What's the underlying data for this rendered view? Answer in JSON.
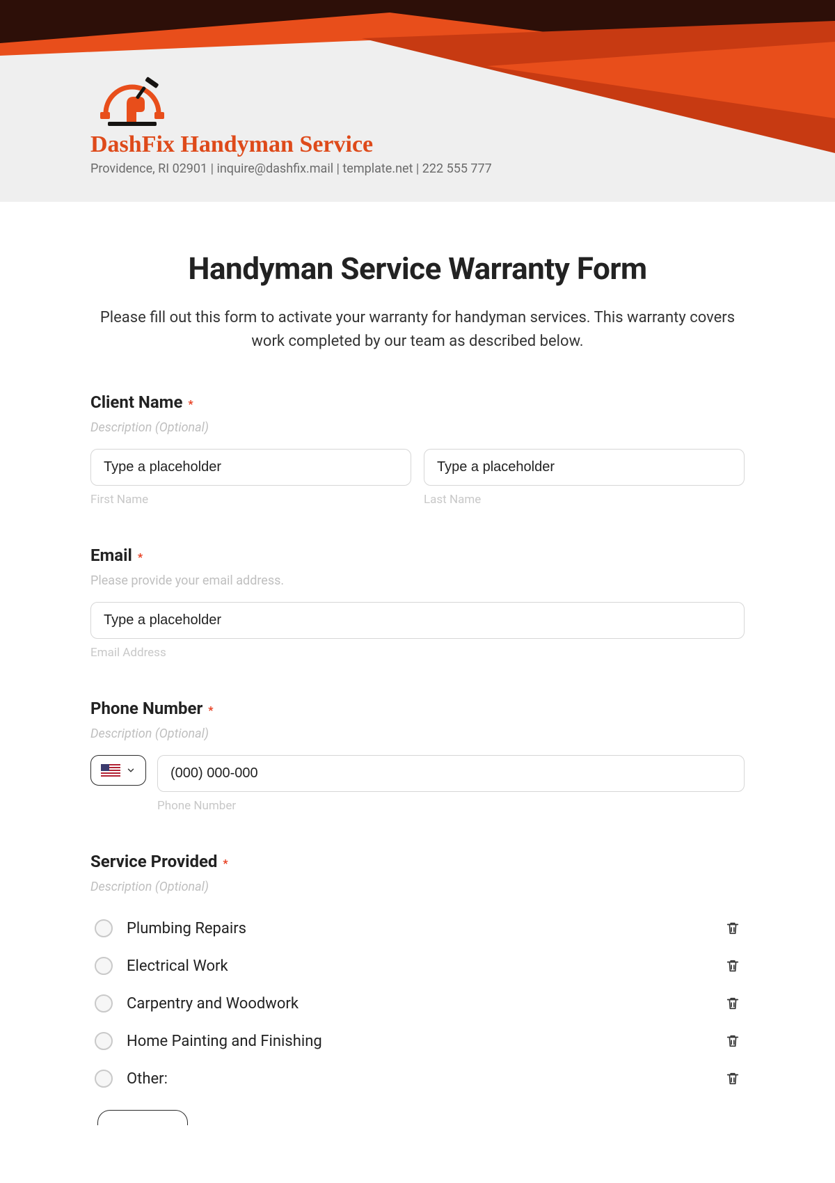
{
  "brand": {
    "name": "DashFix Handyman Service",
    "contact": "Providence, RI 02901 | inquire@dashfix.mail | template.net | 222 555 777"
  },
  "form": {
    "title": "Handyman Service Warranty Form",
    "intro": "Please fill out this form to activate your warranty for handyman services. This warranty covers work completed by our team as described below."
  },
  "client_name": {
    "label": "Client Name",
    "required": "*",
    "desc": "Description (Optional)",
    "first_placeholder": "Type a placeholder",
    "last_placeholder": "Type a placeholder",
    "first_sub": "First Name",
    "last_sub": "Last Name"
  },
  "email": {
    "label": "Email",
    "required": "*",
    "desc": "Please provide your email address.",
    "placeholder": "Type a placeholder",
    "sub": "Email Address"
  },
  "phone": {
    "label": "Phone Number",
    "required": "*",
    "desc": "Description (Optional)",
    "placeholder": "(000) 000-000",
    "sub": "Phone Number"
  },
  "service": {
    "label": "Service Provided",
    "required": "*",
    "desc": "Description (Optional)",
    "options": [
      "Plumbing Repairs",
      "Electrical Work",
      "Carpentry and Woodwork",
      "Home Painting and Finishing",
      "Other:"
    ]
  }
}
